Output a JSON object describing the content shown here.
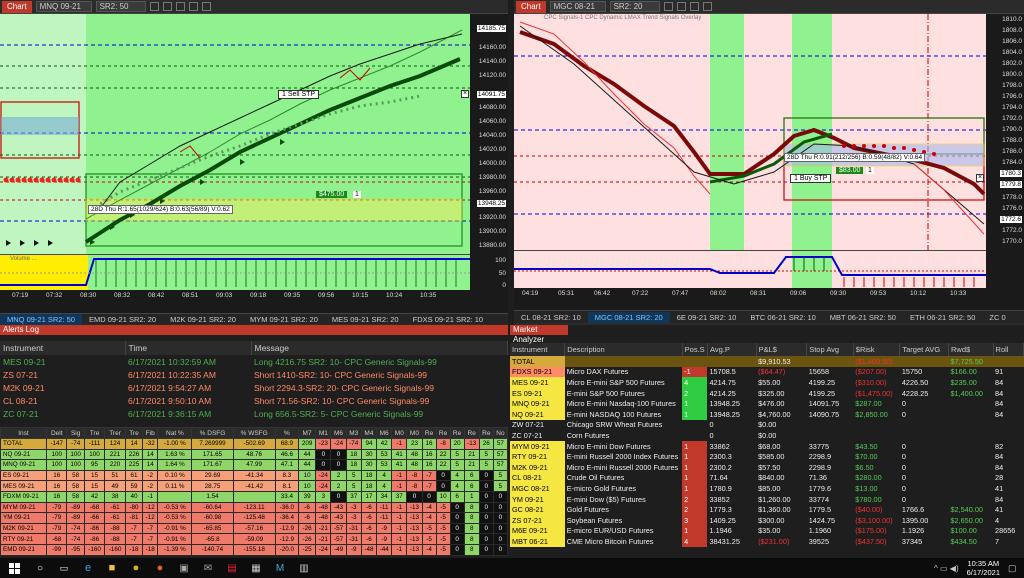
{
  "left_chart": {
    "tab": "Chart",
    "instrument": "MNQ 09-21",
    "timeframe": "SR2: 50",
    "price_labels": [
      "14185.75",
      "14160.00",
      "14140.00",
      "14120.00",
      "14100.00",
      "14080.00",
      "14060.00",
      "14040.00",
      "14020.00",
      "14000.00",
      "13980.00",
      "13960.00",
      "13940.00",
      "13920.00",
      "13900.00",
      "13880.00"
    ],
    "price_last": "14185.75",
    "price_stop": "14091.75",
    "price_entry": "13948.25",
    "sub_labels": [
      "100",
      "50",
      "0"
    ],
    "time_labels": [
      "07:19",
      "07:32",
      "08:30",
      "08:32",
      "08:42",
      "08:51",
      "09:03",
      "09:18",
      "09:35",
      "09:56",
      "10:15",
      "10:24",
      "10:35"
    ],
    "order_label": "1  Sell STP",
    "pnl_label": "$475.00",
    "pnl_qty": "1",
    "stats_label": "28D Thu R:1.65(1029/624) B:0.63(56/89) V:0.62",
    "indicator_label": "Volume ..."
  },
  "right_chart": {
    "tab": "Chart",
    "instrument": "MGC 08-21",
    "timeframe": "SR2: 20",
    "header_text": "CPC Signals-1   CPC Dynamic LMAX Trend Signals Overlay",
    "price_labels": [
      "1810.0",
      "1808.0",
      "1806.0",
      "1804.0",
      "1802.0",
      "1800.0",
      "1798.0",
      "1796.0",
      "1794.0",
      "1792.0",
      "1790.0",
      "1788.0",
      "1786.0",
      "1784.0",
      "1782.0",
      "1780.0",
      "1778.0",
      "1776.0",
      "1774.0",
      "1772.0",
      "1770.0"
    ],
    "price_last": "1779.8",
    "price_mid": "1780.3",
    "price_entry": "1772.6",
    "time_labels": [
      "04:19",
      "05:31",
      "06:42",
      "07:22",
      "07:47",
      "08:02",
      "08:31",
      "09:06",
      "09:30",
      "09:53",
      "10:12",
      "10:33"
    ],
    "order_label": "1  Buy STP",
    "pnl_label": "$83.00",
    "pnl_qty": "1",
    "stats_label": "28D Thu R:0.91(212/256) B:0.59(48/82) V:0.64"
  },
  "left_tabs": [
    "MNQ 09-21 SR2: 50",
    "EMD 09-21 SR2: 20",
    "M2K 09-21 SR2: 20",
    "MYM 09-21 SR2: 20",
    "MES 09-21 SR2: 20",
    "FDXS 09-21 SR2: 10"
  ],
  "right_tabs": [
    "CL 08-21 SR2: 10",
    "MGC 08-21 SR2: 20",
    "6E 09-21 SR2: 10",
    "BTC 06-21 SR2: 10",
    "MBT 06-21 SR2: 50",
    "ETH 06-21 SR2: 50",
    "ZC 0"
  ],
  "alerts": {
    "title": "Alerts Log",
    "headers": [
      "Instrument",
      "Time",
      "Message"
    ],
    "rows": [
      {
        "inst": "MES 09-21",
        "time": "6/17/2021 10:32:59 AM",
        "msg": "Long 4216.75 SR2: 10- CPC Generic Signals-99",
        "color": "#4caf50"
      },
      {
        "inst": "ZS 07-21",
        "time": "6/17/2021 10:22:35 AM",
        "msg": "Short 1410-SR2: 10- CPC Generic Signals-99",
        "color": "#ff8a65"
      },
      {
        "inst": "M2K 09-21",
        "time": "6/17/2021 9:54:27 AM",
        "msg": "Short 2294.3-SR2: 20- CPC Generic Signals-99",
        "color": "#ff8a65"
      },
      {
        "inst": "CL 08-21",
        "time": "6/17/2021 9:50:10 AM",
        "msg": "Short 71.56-SR2: 10- CPC Generic Signals-99",
        "color": "#ff8a65"
      },
      {
        "inst": "ZC 07-21",
        "time": "6/17/2021 9:36:15 AM",
        "msg": "Long 656.5-SR2: 5- CPC Generic Signals-99",
        "color": "#4caf50"
      }
    ]
  },
  "grid": {
    "headers": [
      "Inst",
      "Delt",
      "Sig",
      "Tre",
      "Trer",
      "Tre",
      "Fib",
      "Nat %",
      "% DSFG",
      "% WSFG",
      "%",
      "M7",
      "M1",
      "M6",
      "M3",
      "M4",
      "M6",
      "M0",
      "M0",
      "Re",
      "Re",
      "Re",
      "Re",
      "Re",
      "No"
    ],
    "rows": [
      {
        "inst": "TOTAL",
        "v": [
          "-147",
          "-74",
          "-111",
          "124",
          "14",
          "-32",
          "-1.00 %",
          "7.269999",
          "-502.69",
          "68.9",
          "209",
          "-23",
          "-24",
          "-74",
          "94",
          "42",
          "-1",
          "23",
          "16",
          "-8",
          "20",
          "-13",
          "26",
          "57"
        ],
        "bg": "#d4aa3c"
      },
      {
        "inst": "NQ 09-21",
        "v": [
          "100",
          "100",
          "100",
          "221",
          "226",
          "14",
          "1.63 %",
          "171.65",
          "48.76",
          "46.6",
          "44",
          "0",
          "0",
          "18",
          "30",
          "53",
          "41",
          "48",
          "16",
          "22",
          "5",
          "21",
          "5",
          "57"
        ],
        "bg": "#8fd66a"
      },
      {
        "inst": "MNQ 09-21",
        "v": [
          "100",
          "100",
          "95",
          "220",
          "225",
          "14",
          "1.64 %",
          "171.67",
          "47.99",
          "47.1",
          "44",
          "0",
          "0",
          "18",
          "30",
          "53",
          "41",
          "48",
          "16",
          "22",
          "5",
          "21",
          "5",
          "57"
        ],
        "bg": "#8fd66a"
      },
      {
        "inst": "ES 09-21",
        "v": [
          "16",
          "58",
          "15",
          "51",
          "61",
          "-2",
          "0.10 %",
          "29.69",
          "-41.34",
          "8.3",
          "10",
          "-24",
          "2",
          "5",
          "18",
          "4",
          "-1",
          "-8",
          "-7",
          "0",
          "4",
          "6",
          "0",
          "5"
        ],
        "bg": "#f5a07a"
      },
      {
        "inst": "MES 09-21",
        "v": [
          "16",
          "58",
          "15",
          "49",
          "59",
          "-2",
          "0.11 %",
          "28.75",
          "-41.42",
          "8.1",
          "10",
          "-24",
          "2",
          "5",
          "18",
          "4",
          "-1",
          "-8",
          "-7",
          "0",
          "4",
          "6",
          "0",
          "5"
        ],
        "bg": "#f5a07a"
      },
      {
        "inst": "FDXM 09-21",
        "v": [
          "16",
          "58",
          "42",
          "38",
          "40",
          "-1",
          "",
          "1.54",
          "",
          "33.4",
          "39",
          "3",
          "0",
          "37",
          "17",
          "34",
          "37",
          "0",
          "0",
          "10",
          "6",
          "1",
          "0",
          "0"
        ],
        "bg": "#8fd66a"
      },
      {
        "inst": "MYM 09-21",
        "v": [
          "-79",
          "-89",
          "-68",
          "-61",
          "-80",
          "-12",
          "-0.53 %",
          "-60.64",
          "-123.11",
          "-36.0",
          "-6",
          "-48",
          "-43",
          "-3",
          "-6",
          "-11",
          "-1",
          "-13",
          "-4",
          "-5",
          "0",
          "8",
          "0",
          "0"
        ],
        "bg": "#f07a6a"
      },
      {
        "inst": "YM 09-21",
        "v": [
          "-79",
          "-89",
          "-66",
          "-61",
          "-81",
          "-12",
          "-0.53 %",
          "-60.98",
          "-125.48",
          "-36.4",
          "-6",
          "-48",
          "-43",
          "-3",
          "-6",
          "-11",
          "-1",
          "-13",
          "-4",
          "-5",
          "0",
          "8",
          "0",
          "0"
        ],
        "bg": "#f07a6a"
      },
      {
        "inst": "M2K 09-21",
        "v": [
          "-79",
          "-74",
          "-86",
          "-88",
          "-7",
          "-7",
          "-0.91 %",
          "-65.85",
          "-57.16",
          "-12.9",
          "-26",
          "-21",
          "-57",
          "-31",
          "-6",
          "-9",
          "-1",
          "-13",
          "-5",
          "-5",
          "0",
          "8",
          "0",
          "0"
        ],
        "bg": "#f07a6a"
      },
      {
        "inst": "RTY 09-21",
        "v": [
          "-68",
          "-74",
          "-86",
          "-88",
          "-7",
          "-7",
          "-0.91 %",
          "-65.8",
          "-59.09",
          "-12.9",
          "-26",
          "-21",
          "-57",
          "-31",
          "-6",
          "-9",
          "-1",
          "-13",
          "-5",
          "-5",
          "0",
          "8",
          "0",
          "0"
        ],
        "bg": "#f07a6a"
      },
      {
        "inst": "EMD 09-21",
        "v": [
          "-99",
          "-95",
          "-160",
          "-160",
          "-18",
          "-18",
          "-1.39 %",
          "-140.74",
          "-155.18",
          "-20.0",
          "-25",
          "-24",
          "-49",
          "-9",
          "-48",
          "-44",
          "-1",
          "-13",
          "-4",
          "-5",
          "0",
          "8",
          "0",
          "0"
        ],
        "bg": "#f07a6a"
      }
    ]
  },
  "market": {
    "title": "Market Analyzer",
    "headers": [
      "Instrument",
      "Description",
      "Pos.S",
      "Avg.P",
      "P&L$",
      "Stop Avg",
      "$Risk",
      "Target AVG",
      "Rwd$",
      "Roll"
    ],
    "rows": [
      {
        "inst": "TOTAL",
        "desc": "",
        "pos": "",
        "avg": "",
        "pnl": "$9,910.53",
        "stop": "",
        "risk": "($1,409.50)",
        "tgt": "",
        "rwd": "$7,725.50",
        "roll": "",
        "bg": "#d4aa3c",
        "posbg": ""
      },
      {
        "inst": "FDXS 09-21",
        "desc": "Micro DAX Futures",
        "pos": "-1",
        "avg": "15708.5",
        "pnl": "($64.47)",
        "stop": "15658",
        "risk": "($207.00)",
        "tgt": "15750",
        "rwd": "$166.00",
        "roll": "91",
        "bg": "#ff8a65",
        "posbg": "#c0392b"
      },
      {
        "inst": "MES 09-21",
        "desc": "Micro E-mini S&P 500 Futures",
        "pos": "4",
        "avg": "4214.75",
        "pnl": "$55.00",
        "stop": "4199.25",
        "risk": "($310.00)",
        "tgt": "4226.50",
        "rwd": "$235.00",
        "roll": "84",
        "bg": "#f5e642",
        "posbg": "#2ecc40"
      },
      {
        "inst": "ES 09-21",
        "desc": "E-mini S&P 500 Futures",
        "pos": "2",
        "avg": "4214.25",
        "pnl": "$325.00",
        "stop": "4199.25",
        "risk": "($1,475.00)",
        "tgt": "4228.25",
        "rwd": "$1,400.00",
        "roll": "84",
        "bg": "#f5e642",
        "posbg": "#2ecc40"
      },
      {
        "inst": "MNQ 09-21",
        "desc": "Micro E-mini Nasdaq-100 Futures",
        "pos": "1",
        "avg": "13948.25",
        "pnl": "$476.00",
        "stop": "14091.75",
        "risk": "$287.00",
        "tgt": "0",
        "rwd": "",
        "roll": "84",
        "bg": "#f5e642",
        "posbg": "#2ecc40"
      },
      {
        "inst": "NQ 09-21",
        "desc": "E-mini NASDAQ 100 Futures",
        "pos": "1",
        "avg": "13948.25",
        "pnl": "$4,760.00",
        "stop": "14090.75",
        "risk": "$2,850.00",
        "tgt": "0",
        "rwd": "",
        "roll": "84",
        "bg": "#f5e642",
        "posbg": "#2ecc40"
      },
      {
        "inst": "ZW 07-21",
        "desc": "Chicago SRW Wheat Futures",
        "pos": "",
        "avg": "0",
        "pnl": "$0.00",
        "stop": "",
        "risk": "",
        "tgt": "",
        "rwd": "",
        "roll": "",
        "bg": "",
        "posbg": ""
      },
      {
        "inst": "ZC 07-21",
        "desc": "Corn Futures",
        "pos": "",
        "avg": "0",
        "pnl": "$0.00",
        "stop": "",
        "risk": "",
        "tgt": "",
        "rwd": "",
        "roll": "",
        "bg": "",
        "posbg": ""
      },
      {
        "inst": "MYM 09-21",
        "desc": "Micro E-mini Dow Futures",
        "pos": "1",
        "avg": "33862",
        "pnl": "$68.00",
        "stop": "33775",
        "risk": "$43.50",
        "tgt": "0",
        "rwd": "",
        "roll": "82",
        "bg": "#f5e642",
        "posbg": "#c0392b"
      },
      {
        "inst": "RTY 09-21",
        "desc": "E-mini Russell 2000 Index Futures",
        "pos": "1",
        "avg": "2300.3",
        "pnl": "$585.00",
        "stop": "2298.9",
        "risk": "$70.00",
        "tgt": "0",
        "rwd": "",
        "roll": "84",
        "bg": "#f5e642",
        "posbg": "#c0392b"
      },
      {
        "inst": "M2K 09-21",
        "desc": "Micro E-mini Russell 2000 Futures",
        "pos": "1",
        "avg": "2300.2",
        "pnl": "$57.50",
        "stop": "2298.9",
        "risk": "$6.50",
        "tgt": "0",
        "rwd": "",
        "roll": "84",
        "bg": "#f5e642",
        "posbg": "#c0392b"
      },
      {
        "inst": "CL 08-21",
        "desc": "Crude Oil Futures",
        "pos": "1",
        "avg": "71.64",
        "pnl": "$840.00",
        "stop": "71.36",
        "risk": "$280.00",
        "tgt": "0",
        "rwd": "",
        "roll": "28",
        "bg": "#f5e642",
        "posbg": "#c0392b"
      },
      {
        "inst": "MGC 08-21",
        "desc": "E-micro Gold Futures",
        "pos": "1",
        "avg": "1780.9",
        "pnl": "$85.00",
        "stop": "1779.6",
        "risk": "$13.00",
        "tgt": "0",
        "rwd": "",
        "roll": "41",
        "bg": "#f5e642",
        "posbg": "#c0392b"
      },
      {
        "inst": "YM 09-21",
        "desc": "E-mini Dow ($5) Futures",
        "pos": "2",
        "avg": "33852",
        "pnl": "$1,260.00",
        "stop": "33774",
        "risk": "$780.00",
        "tgt": "0",
        "rwd": "",
        "roll": "84",
        "bg": "#f5e642",
        "posbg": "#c0392b"
      },
      {
        "inst": "GC 08-21",
        "desc": "Gold Futures",
        "pos": "2",
        "avg": "1779.3",
        "pnl": "$1,360.00",
        "stop": "1779.5",
        "risk": "($40.00)",
        "tgt": "1766.6",
        "rwd": "$2,540.00",
        "roll": "41",
        "bg": "#f5e642",
        "posbg": "#c0392b"
      },
      {
        "inst": "ZS 07-21",
        "desc": "Soybean Futures",
        "pos": "3",
        "avg": "1409.25",
        "pnl": "$300.00",
        "stop": "1424.75",
        "risk": "($3,100.00)",
        "tgt": "1395.00",
        "rwd": "$2,650.00",
        "roll": "4",
        "bg": "#f5e642",
        "posbg": "#c0392b"
      },
      {
        "inst": "M6E 09-21",
        "desc": "E-micro EUR/USD Futures",
        "pos": "1",
        "avg": "1.1946",
        "pnl": "$35.00",
        "stop": "1.1960",
        "risk": "($175.00)",
        "tgt": "1.1926",
        "rwd": "$100.00",
        "roll": "28656",
        "bg": "#f5e642",
        "posbg": "#c0392b"
      },
      {
        "inst": "MBT 06-21",
        "desc": "CME Micro Bitcoin Futures",
        "pos": "4",
        "avg": "38431.25",
        "pnl": "($231.00)",
        "stop": "39525",
        "risk": "($437.50)",
        "tgt": "37345",
        "rwd": "$434.50",
        "roll": "7",
        "bg": "#f5e642",
        "posbg": "#c0392b"
      }
    ]
  },
  "taskbar": {
    "time": "10:35 AM",
    "date": "6/17/2021"
  }
}
